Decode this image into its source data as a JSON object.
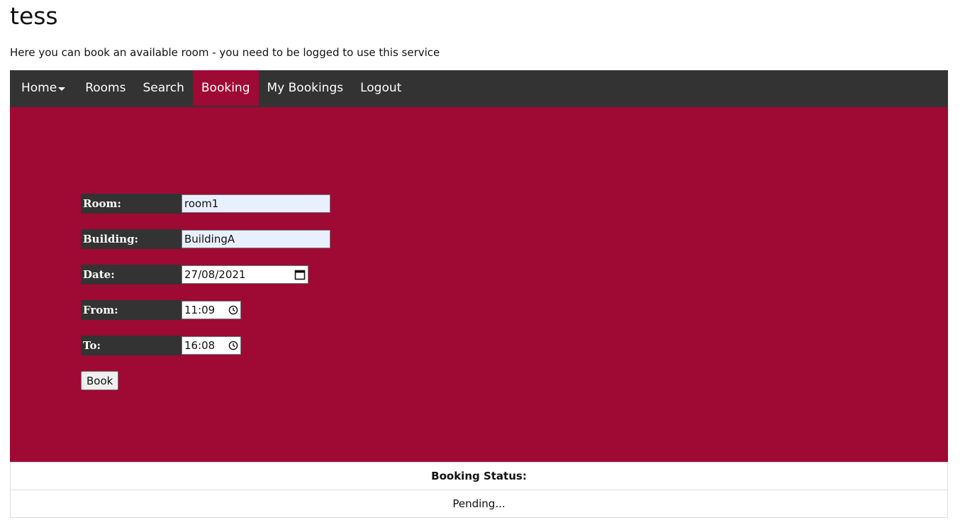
{
  "page": {
    "title": "tess",
    "intro": "Here you can book an available room - you need to be logged to use this service"
  },
  "nav": {
    "items": [
      {
        "label": "Home"
      },
      {
        "label": "Rooms"
      },
      {
        "label": "Search"
      },
      {
        "label": "Booking"
      },
      {
        "label": "My Bookings"
      },
      {
        "label": "Logout"
      }
    ],
    "active": "Booking",
    "colors": {
      "bar": "#333333",
      "active": "#9e0a34",
      "text": "#ffffff"
    }
  },
  "form": {
    "room": {
      "label": "Room:",
      "value": "room1"
    },
    "building": {
      "label": "Building:",
      "value": "BuildingA"
    },
    "date": {
      "label": "Date:",
      "value": "27/08/2021",
      "icon": "calendar-icon"
    },
    "from": {
      "label": "From:",
      "value": "11:09",
      "icon": "clock-icon"
    },
    "to": {
      "label": "To:",
      "value": "16:08",
      "icon": "clock-icon"
    },
    "book_label": "Book",
    "panel_color": "#9e0a34"
  },
  "status": {
    "header": "Booking Status:",
    "value": "Pending..."
  }
}
